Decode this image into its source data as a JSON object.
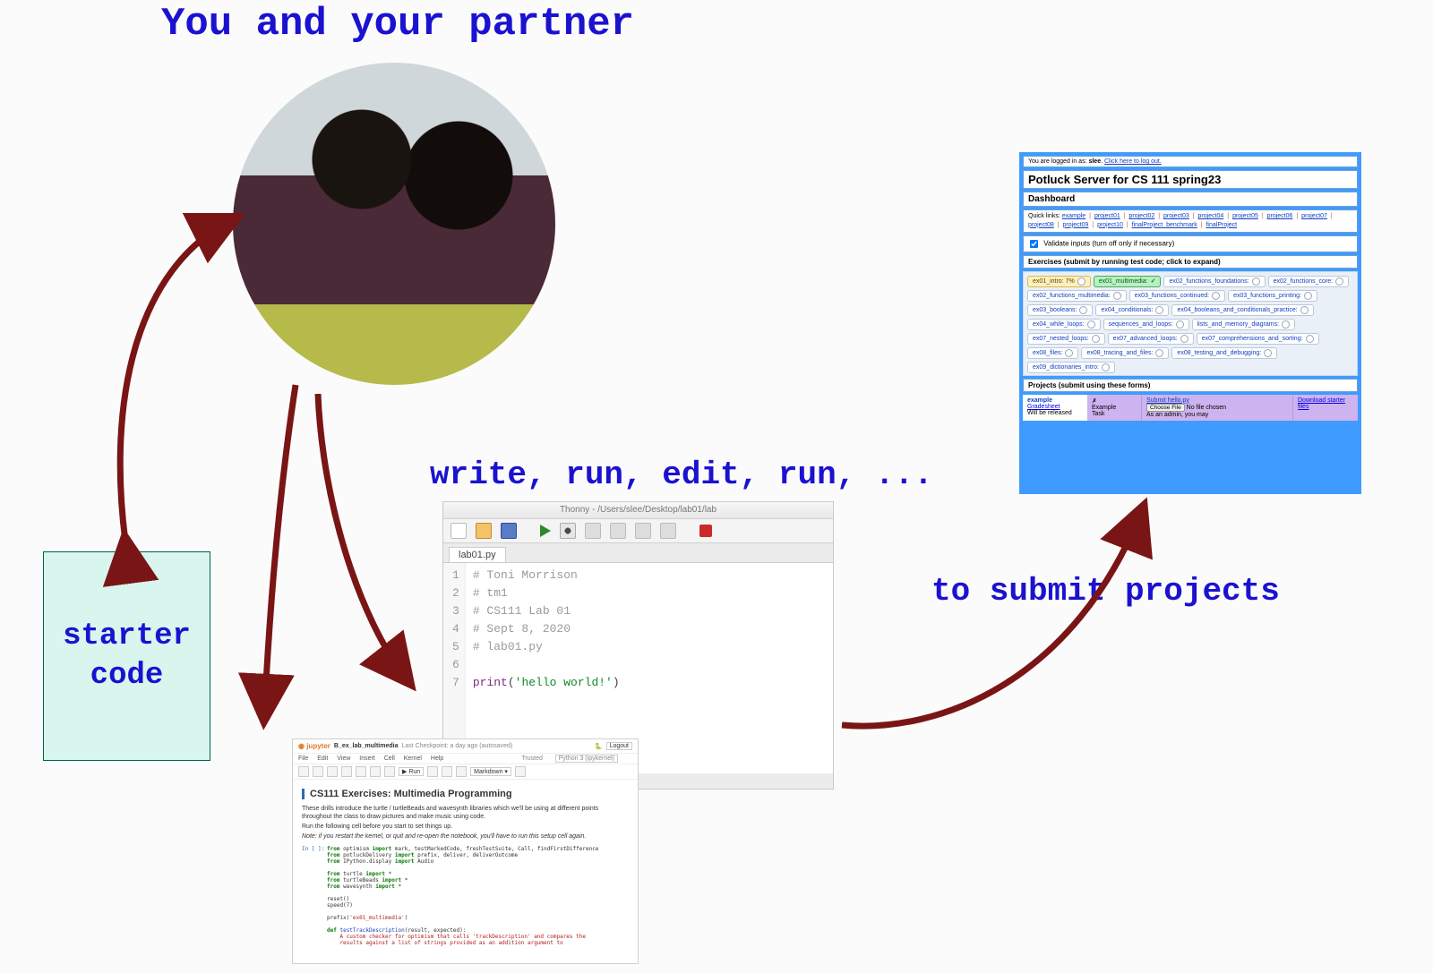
{
  "labels": {
    "top": "You and your partner",
    "mid": "write, run, edit, run, ...",
    "right": "to submit projects",
    "starter": "starter\ncode"
  },
  "thonny": {
    "title": "Thonny  -  /Users/slee/Desktop/lab01/lab",
    "tab": "lab01.py",
    "code_lines": [
      "# Toni Morrison",
      "# tm1",
      "# CS111 Lab 01",
      "# Sept 8, 2020",
      "# lab01.py",
      "",
      "print('hello world!')"
    ]
  },
  "jupyter": {
    "filename": "B_ex_lab_multimedia",
    "checkpoint": "Last Checkpoint: a day ago  (autosaved)",
    "logout": "Logout",
    "menus": [
      "File",
      "Edit",
      "View",
      "Insert",
      "Cell",
      "Kernel",
      "Help"
    ],
    "trusted": "Trusted",
    "kernel": "Python 3 (ipykernel)",
    "tool_run": "Run",
    "tool_celltype": "Markdown",
    "title": "CS111 Exercises: Multimedia Programming",
    "intro1": "These drills introduce the turtle / turtleBeads and wavesynth libraries which we'll be using at different points throughout the class to draw pictures and make music using code.",
    "intro2": "Run the following cell before you start to set things up.",
    "intro3": "Note: if you restart the kernel, or quit and re-open the notebook, you'll have to run this setup cell again.",
    "prompt": "In [ ]:",
    "cell_lines": [
      "from optimism import mark, testMarkedCode, freshTestSuite, Call, findFirstDifference",
      "from potluckDelivery import prefix, deliver, deliverOutcome",
      "from IPython.display import Audio",
      "",
      "from turtle import *",
      "from turtleBeads import *",
      "from wavesynth import *",
      "",
      "reset()",
      "speed(7)",
      "",
      "prefix('ex01_multimedia')",
      "",
      "def testTrackDescription(result, expected):",
      "    A custom checker for optimism that calls 'trackDescription' and compares the",
      "    results against a list of strings provided as an addition argument to"
    ]
  },
  "potluck": {
    "login_pre": "You are logged in as: ",
    "login_user": "slee",
    "login_link": "Click here to log out.",
    "server_title": "Potluck Server for CS 111 spring23",
    "dashboard": "Dashboard",
    "quick_label": "Quick links: ",
    "quick_links": [
      "example",
      "project01",
      "project02",
      "project03",
      "project04",
      "project05",
      "project06",
      "project07",
      "project08",
      "project09",
      "project10",
      "finalProject_benchmark",
      "finalProject"
    ],
    "validate_label": "Validate inputs (turn off only if necessary)",
    "ex_header": "Exercises (submit by running test code; click to expand)",
    "exercises": [
      {
        "label": "ex01_intro: 7%",
        "kind": "intro"
      },
      {
        "label": "ex01_multimedia:",
        "kind": "ok"
      },
      {
        "label": "ex02_functions_foundations:",
        "kind": ""
      },
      {
        "label": "ex02_functions_core:",
        "kind": ""
      },
      {
        "label": "ex02_functions_multimedia:",
        "kind": ""
      },
      {
        "label": "ex03_functions_continued:",
        "kind": ""
      },
      {
        "label": "ex03_functions_printing:",
        "kind": ""
      },
      {
        "label": "ex03_booleans:",
        "kind": ""
      },
      {
        "label": "ex04_conditionals:",
        "kind": ""
      },
      {
        "label": "ex04_booleans_and_conditionals_practice:",
        "kind": ""
      },
      {
        "label": "ex04_while_loops:",
        "kind": ""
      },
      {
        "label": "sequences_and_loops:",
        "kind": ""
      },
      {
        "label": "lists_and_memory_diagrams:",
        "kind": ""
      },
      {
        "label": "ex07_nested_loops:",
        "kind": ""
      },
      {
        "label": "ex07_advanced_loops:",
        "kind": ""
      },
      {
        "label": "ex07_comprehensions_and_sorting:",
        "kind": ""
      },
      {
        "label": "ex08_files:",
        "kind": ""
      },
      {
        "label": "ex08_tracing_and_files:",
        "kind": ""
      },
      {
        "label": "ex08_testing_and_debugging:",
        "kind": ""
      },
      {
        "label": "ex09_dictionaries_intro:",
        "kind": ""
      }
    ],
    "proj_header": "Projects (submit using these forms)",
    "proj": {
      "name": "example",
      "gradesheet": "Gradesheet",
      "release": "Will be released",
      "task_hdr": "✗\nExample\nTask",
      "submit_label": "Submit hello.py",
      "choose": "Choose File",
      "nofile": "No file chosen",
      "admin": "As an admin, you may",
      "download": "Download starter files"
    }
  }
}
